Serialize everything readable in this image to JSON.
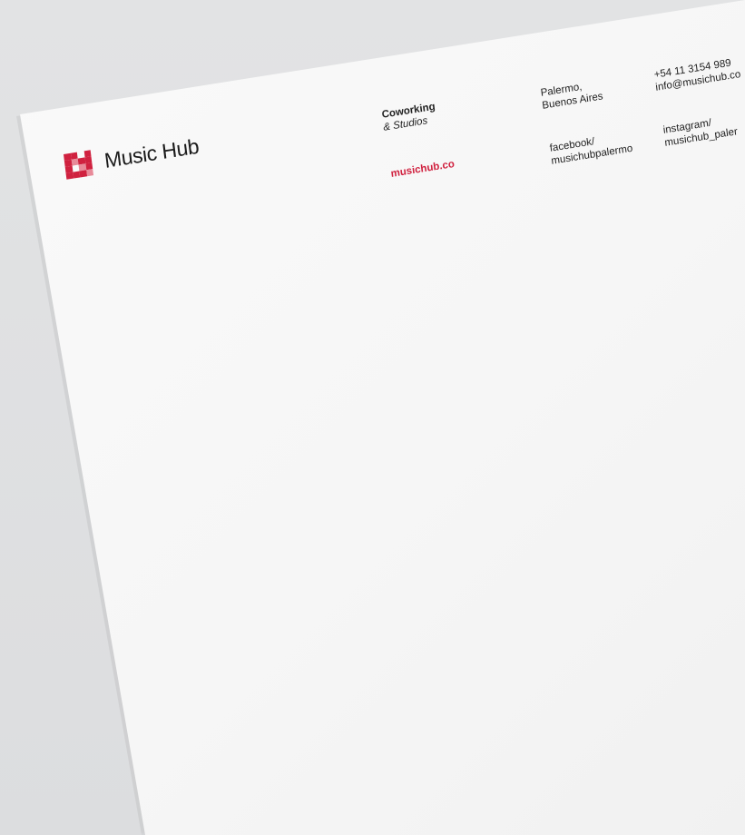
{
  "brand": {
    "name": "Music Hub",
    "accent_color": "#d0213f"
  },
  "letterhead": {
    "tagline_line1": "Coworking",
    "tagline_line2": "& Studios",
    "website": "musichub.co",
    "address_line1": "Palermo,",
    "address_line2": "Buenos Aires",
    "facebook_line1": "facebook/",
    "facebook_line2": "musichubpalermo",
    "phone": "+54 11 3154 989",
    "email": "info@musichub.co",
    "instagram_line1": "instagram/",
    "instagram_line2": "musichub_paler"
  }
}
